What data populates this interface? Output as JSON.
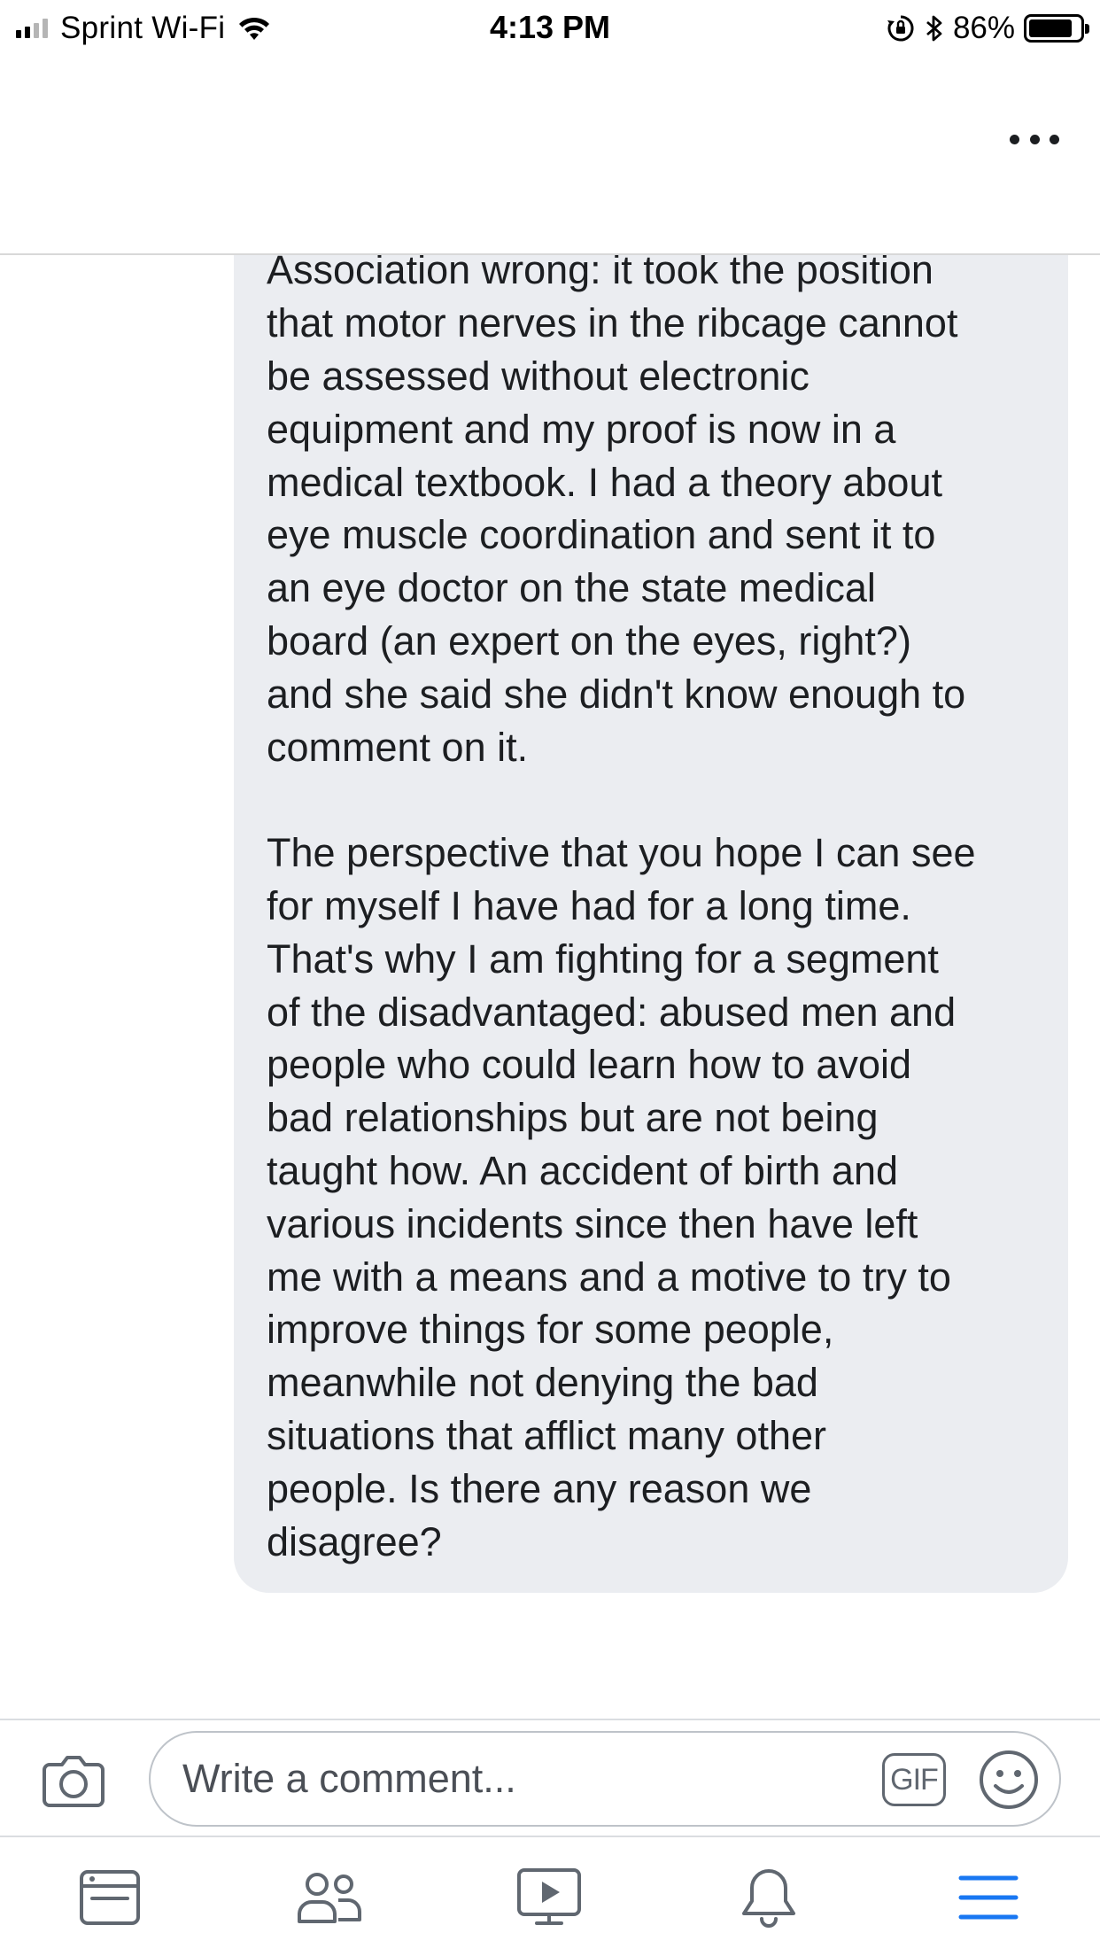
{
  "status_bar": {
    "carrier": "Sprint Wi-Fi",
    "time": "4:13 PM",
    "battery_percent": "86%",
    "battery_level": 0.86,
    "icons": [
      "signal-icon",
      "wifi-icon",
      "orientation-lock-icon",
      "bluetooth-icon",
      "battery-icon"
    ]
  },
  "header": {
    "more_icon": "more-options-icon"
  },
  "comment": {
    "paragraphs": [
      "right, then a pilot who flew ...\nwent around the earth. More recently, I\nproved the American Spinal Injury\nAssociation wrong: it took the position\nthat motor nerves in the ribcage cannot\nbe assessed without electronic\nequipment and my proof is now in a\nmedical textbook. I had a theory about\neye muscle coordination and sent it to\nan eye doctor on the state medical\nboard (an expert on the eyes, right?)\nand she said she didn't know enough to\ncomment on it.",
      "The perspective that you hope I can see\nfor myself I have had for a long time.\nThat's why I am fighting for a segment\nof the disadvantaged: abused men and\npeople who could learn how to avoid\nbad relationships but are not being\ntaught how. An accident of birth and\nvarious incidents since then have left\nme with a means and a motive to try to\nimprove things for some people,\nmeanwhile not denying the bad\nsituations that afflict many other\npeople. Is there any reason we\ndisagree?"
    ]
  },
  "composer": {
    "placeholder": "Write a comment...",
    "value": "",
    "gif_label": "GIF",
    "camera_icon": "camera-icon",
    "emoji_icon": "emoji-icon"
  },
  "tabbar": {
    "tabs": [
      {
        "icon": "news-feed-icon",
        "active": false
      },
      {
        "icon": "friends-icon",
        "active": false
      },
      {
        "icon": "watch-icon",
        "active": false
      },
      {
        "icon": "notifications-icon",
        "active": false
      },
      {
        "icon": "menu-icon",
        "active": true
      }
    ]
  },
  "colors": {
    "accent": "#1877f2",
    "bubble": "#ebedf1",
    "text": "#1c1e21",
    "icon": "#606770"
  }
}
